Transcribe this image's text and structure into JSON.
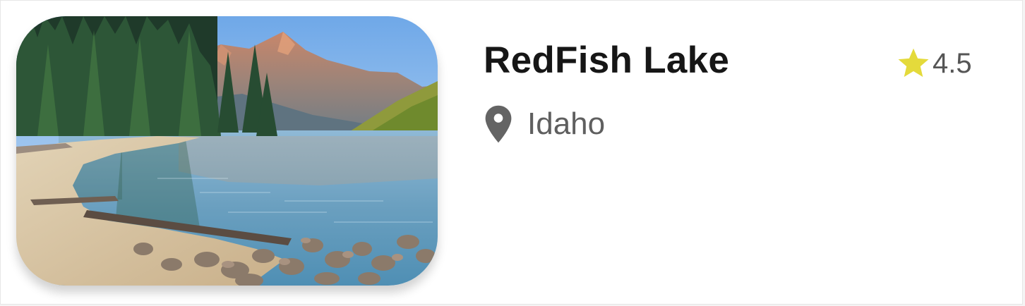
{
  "place": {
    "name": "RedFish Lake",
    "location": "Idaho",
    "rating": "4.5"
  },
  "icons": {
    "rating": "star-icon",
    "location": "map-pin-icon"
  },
  "colors": {
    "star": "#E4DA3B",
    "title": "#161616",
    "secondary_text": "#5F5F5F",
    "pin": "#646464"
  },
  "photo": {
    "subject": "mountain lake with pine forest and rocky shore"
  }
}
